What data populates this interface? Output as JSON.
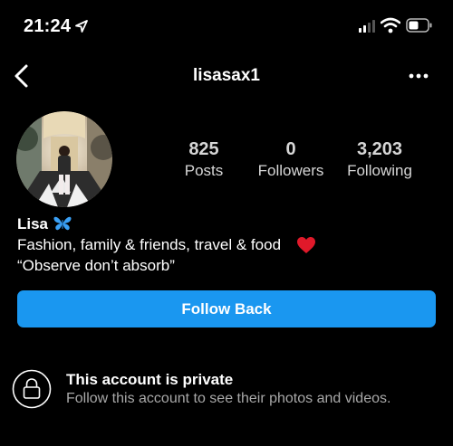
{
  "status_bar": {
    "time": "21:24"
  },
  "header": {
    "username": "lisasax1"
  },
  "profile": {
    "stats": [
      {
        "value": "825",
        "label": "Posts"
      },
      {
        "value": "0",
        "label": "Followers"
      },
      {
        "value": "3,203",
        "label": "Following"
      }
    ],
    "display_name": "Lisa",
    "bio_line1": "Fashion, family & friends, travel & food",
    "bio_line2": "“Observe don’t absorb”"
  },
  "actions": {
    "follow_label": "Follow Back"
  },
  "private_notice": {
    "title": "This account is private",
    "subtitle": "Follow this account to see their photos and videos."
  },
  "icons": [
    "location-arrow-icon",
    "signal-icon",
    "wifi-icon",
    "battery-icon",
    "chevron-left-icon",
    "more-icon",
    "butterfly-icon",
    "heart-icon",
    "lock-icon"
  ],
  "colors": {
    "background": "#000000",
    "button": "#1a97f0",
    "subtext": "#a8a8a8",
    "heart": "#e0192a",
    "butterfly": "#3aa0f5"
  }
}
